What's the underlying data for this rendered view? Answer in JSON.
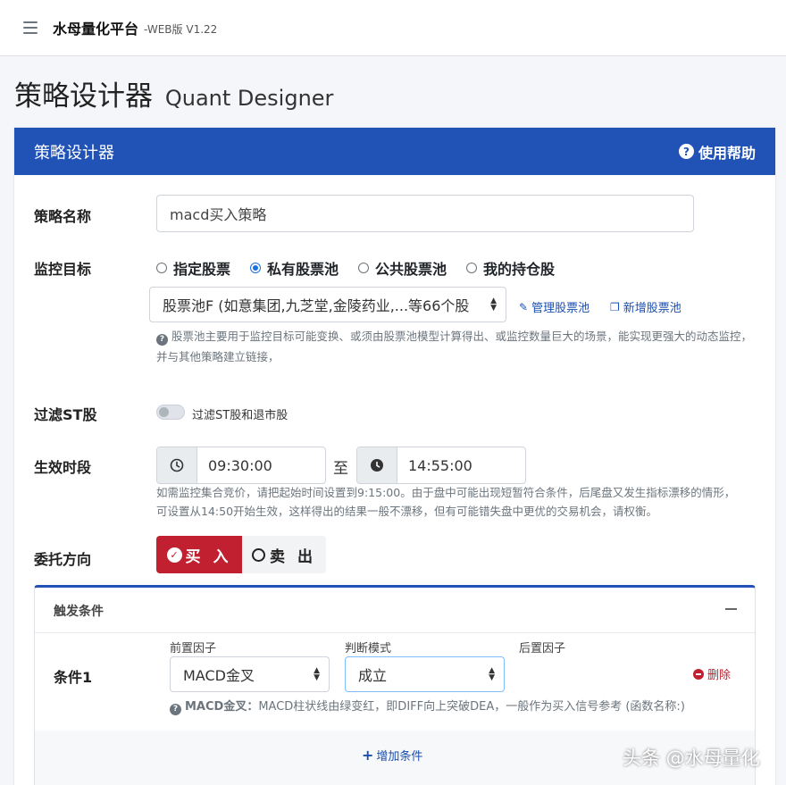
{
  "header": {
    "brand": "水母量化平台",
    "version": "-WEB版 V1.22"
  },
  "page": {
    "title": "策略设计器",
    "subtitle": "Quant Designer"
  },
  "card": {
    "title": "策略设计器",
    "help_label": "使用帮助"
  },
  "form": {
    "name_label": "策略名称",
    "name_value": "macd买入策略",
    "target_label": "监控目标",
    "target_options": [
      "指定股票",
      "私有股票池",
      "公共股票池",
      "我的持仓股"
    ],
    "target_selected": "私有股票池",
    "pool_select": "股票池F (如意集团,九芝堂,金陵药业,...等66个股",
    "manage_pool": "管理股票池",
    "new_pool": "新增股票池",
    "pool_help": "股票池主要用于监控目标可能变换、或须由股票池模型计算得出、或监控数量巨大的场景，能实现更强大的动态监控，并与其他策略建立链接，",
    "filter_label": "过滤ST股",
    "filter_toggle_label": "过滤ST股和退市股",
    "time_label": "生效时段",
    "time_start": "09:30:00",
    "time_to": "至",
    "time_end": "14:55:00",
    "time_help": "如需监控集合竞价，请把起始时间设置到9:15:00。由于盘中可能出现短暂符合条件，后尾盘又发生指标漂移的情形，可设置从14:50开始生效，这样得出的结果一般不漂移，但有可能错失盘中更优的交易机会，请权衡。",
    "direction_label": "委托方向",
    "buy_label": "买 入",
    "sell_label": "卖 出"
  },
  "trigger": {
    "title": "触发条件",
    "condition_label": "条件1",
    "pre_factor_label": "前置因子",
    "mode_label": "判断模式",
    "post_factor_label": "后置因子",
    "pre_factor_value": "MACD金叉",
    "mode_value": "成立",
    "delete_label": "删除",
    "desc_term": "MACD金叉：",
    "desc_text": "MACD柱状线由绿变红，即DIFF向上突破DEA，一般作为买入信号参考 (函数名称:)",
    "add_label": "增加条件"
  },
  "watermark": "头条 @水母量化",
  "colors": {
    "primary": "#2153b7",
    "danger": "#c0202f"
  }
}
